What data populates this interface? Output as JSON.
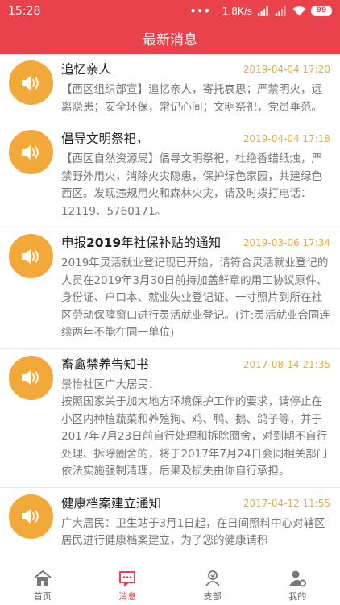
{
  "status_bar": {
    "time": "15:28",
    "dots": "•••",
    "network_speed": "1.8K/s",
    "battery": "99"
  },
  "header": {
    "title": "最新消息"
  },
  "messages": [
    {
      "title": "追忆亲人",
      "date": "2019-04-04 17:20",
      "content": "【西区组织部宣】追忆亲人，寄托哀思；严禁明火，远离隐患；安全环保，常记心间；文明祭祀，党员垂范。"
    },
    {
      "title": "倡导文明祭祀，",
      "date": "2019-04-04 17:18",
      "content": "【西区自然资源局】倡导文明祭祀，杜绝香蜡纸烛，严禁野外用火，消除火灾隐患，保护绿色家园，共建绿色西区。发现违规用火和森林火灾，请及时拨打电话：12119、5760171。"
    },
    {
      "title": "申报2019年社保补贴的通知",
      "date": "2019-03-06 17:34",
      "content": "2019年灵活就业登记现已开始，请符合灵活就业登记的人员在2019年3月30日前持加盖鲜章的用工协议原件、身份证、户口本、就业失业登记证、一寸照片到所在社区劳动保障窗口进行灵活就业登记。(注:灵活就业合同连续两年不能在同一单位)"
    },
    {
      "title": "畜禽禁养告知书",
      "date": "2017-08-14 21:35",
      "content": "景怡社区广大居民：\n按照国家关于加大地方环境保护工作的要求，请停止在小区内种植蔬菜和养殖狗、鸡、鸭、鹅、鸽子等，并于2017年7月23日前自行处理和拆除圈舍，对到期不自行处理、拆除圈舍的，将于2017年7月24日会同相关部门依法实施强制清理，后果及损失由你自行承担。"
    },
    {
      "title": "健康档案建立通知",
      "date": "2017-04-12 11:55",
      "content": "广大居民：卫生站于3月1日起，在日间照料中心对辖区居民进行健康档案建立，为了您的健康请积"
    }
  ],
  "tabbar": {
    "items": [
      {
        "label": "首页",
        "icon": "home-icon"
      },
      {
        "label": "消息",
        "icon": "message-icon"
      },
      {
        "label": "支部",
        "icon": "branch-icon"
      },
      {
        "label": "我的",
        "icon": "profile-settings-icon"
      }
    ],
    "active_index": 1
  },
  "colors": {
    "primary": "#e8434b",
    "accent_orange": "#f2a93a",
    "text_gray": "#777777"
  }
}
